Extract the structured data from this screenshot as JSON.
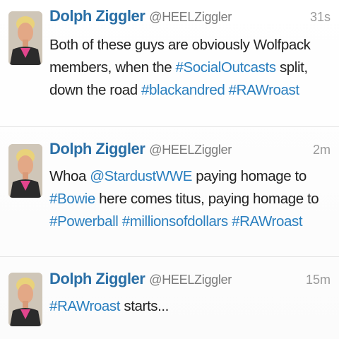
{
  "colors": {
    "name": "#2a6fa6",
    "link": "#2a7fbf",
    "text": "#222222",
    "meta": "#7a7a7a"
  },
  "tweets": [
    {
      "name": "Dolph Ziggler",
      "handle": "@HEELZiggler",
      "time": "31s",
      "avatar_icon": "user-avatar-photo",
      "segments": [
        {
          "text": "Both of these guys are obviously Wolfpack members, when the ",
          "link": false
        },
        {
          "text": "#SocialOutcasts",
          "link": true
        },
        {
          "text": " split, down the road ",
          "link": false
        },
        {
          "text": "#blackandred",
          "link": true
        },
        {
          "text": " ",
          "link": false
        },
        {
          "text": "#RAWroast",
          "link": true
        }
      ]
    },
    {
      "name": "Dolph Ziggler",
      "handle": "@HEELZiggler",
      "time": "2m",
      "avatar_icon": "user-avatar-photo",
      "segments": [
        {
          "text": "Whoa ",
          "link": false
        },
        {
          "text": "@StardustWWE",
          "link": true
        },
        {
          "text": " paying homage to ",
          "link": false
        },
        {
          "text": "#Bowie",
          "link": true
        },
        {
          "text": " here comes titus, paying homage to ",
          "link": false
        },
        {
          "text": "#Powerball",
          "link": true
        },
        {
          "text": " ",
          "link": false
        },
        {
          "text": "#millionsofdollars",
          "link": true
        },
        {
          "text": " ",
          "link": false
        },
        {
          "text": "#RAWroast",
          "link": true
        }
      ]
    },
    {
      "name": "Dolph Ziggler",
      "handle": "@HEELZiggler",
      "time": "15m",
      "avatar_icon": "user-avatar-photo",
      "segments": [
        {
          "text": "#RAWroast",
          "link": true
        },
        {
          "text": " starts...",
          "link": false
        }
      ]
    }
  ]
}
